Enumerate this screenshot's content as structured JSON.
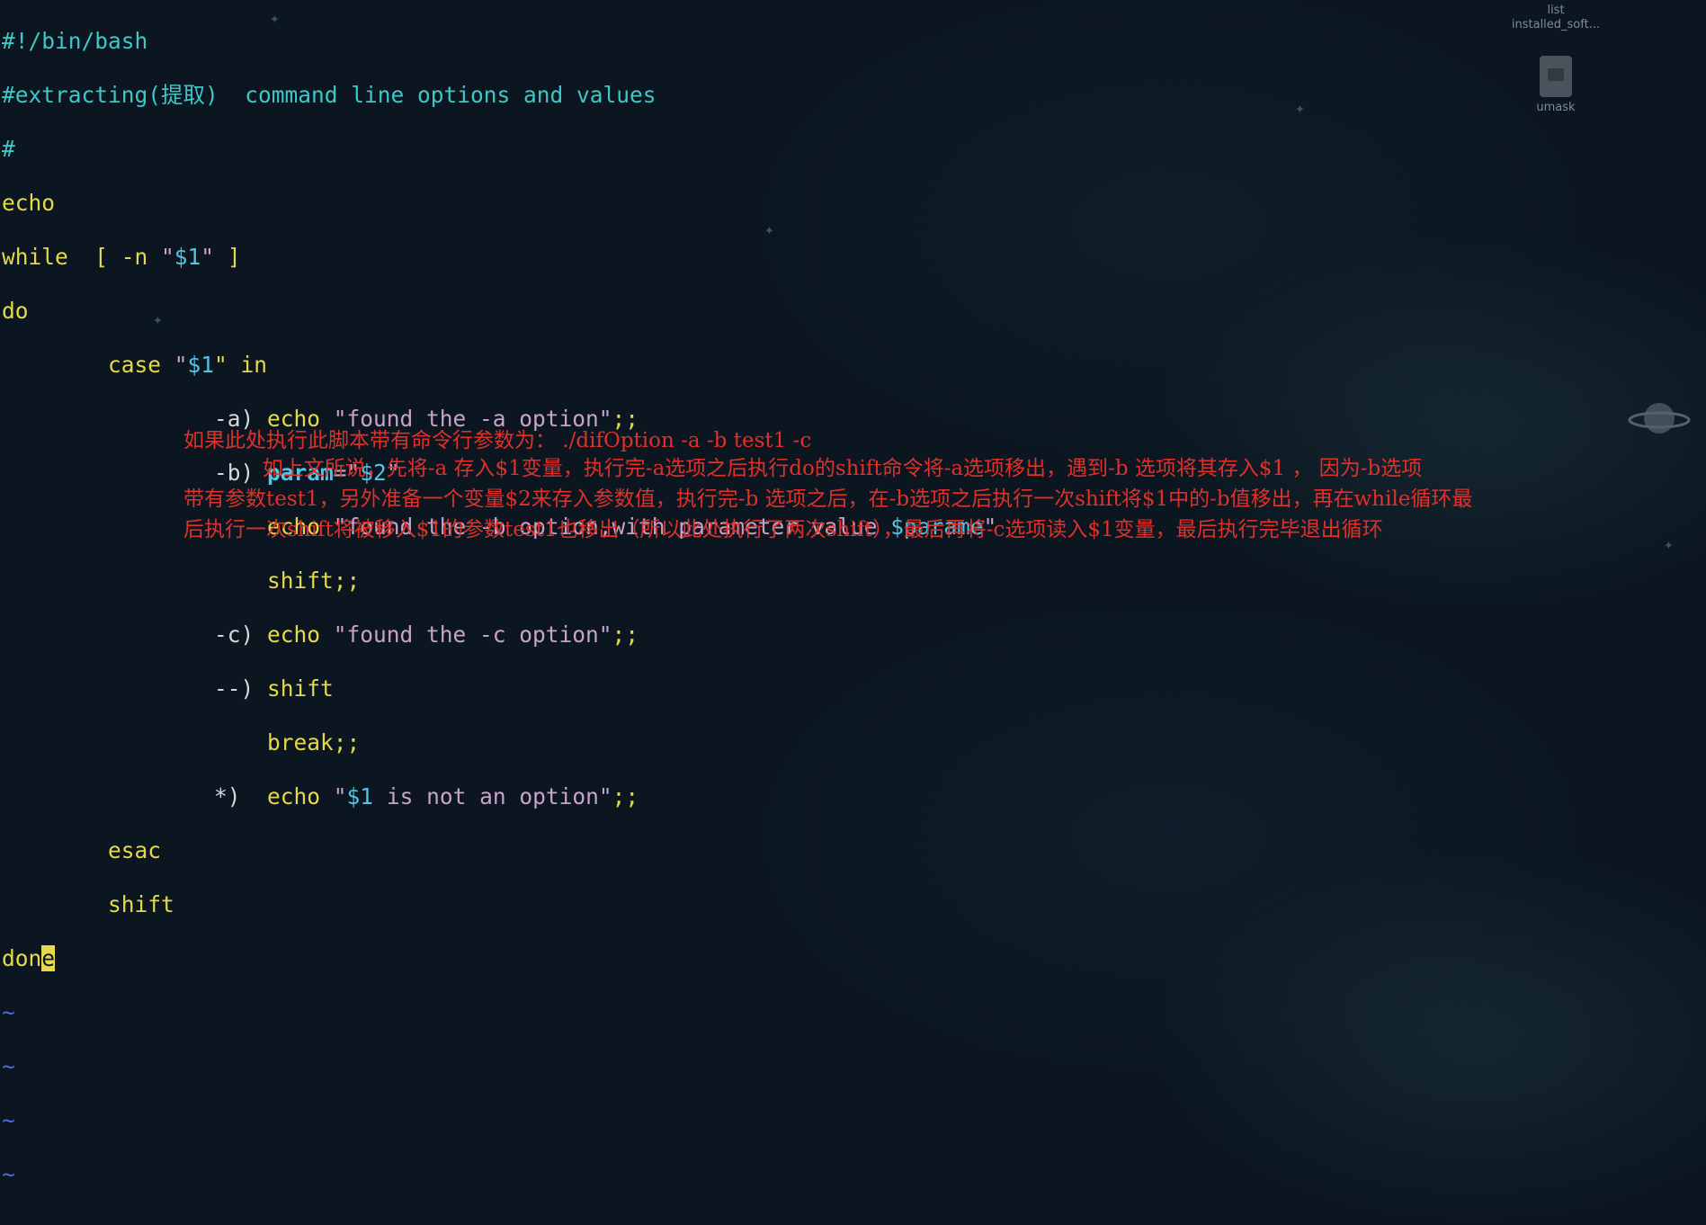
{
  "desktop": {
    "icons": [
      {
        "label_line1": "list",
        "label_line2": "installed_soft..."
      },
      {
        "label": "umask"
      }
    ]
  },
  "editor": {
    "lines": {
      "l1": "#!/bin/bash",
      "l2": "#extracting(提取)  command line options and values",
      "l3": "#",
      "l4": "echo",
      "l5a": "while  [ -n ",
      "l5b": "\"",
      "l5c": "$1",
      "l5d": "\"",
      "l5e": " ]",
      "l6": "do",
      "l7a": "        case ",
      "l7b": "\"",
      "l7c": "$1",
      "l7d": "\" in",
      "l8a": "                -a) ",
      "l8b": "echo ",
      "l8c": "\"found the -a option\"",
      "l8d": ";;",
      "l9a": "                -b) ",
      "l9b": "param",
      "l9c": "=\"",
      "l9d": "$2",
      "l9e": "\"",
      "l10a": "                    echo ",
      "l10b": "\"found the -b option,with parameter value ",
      "l10c": "$parame",
      "l10d": "\"",
      "l11": "                    shift;;",
      "l12a": "                -c) ",
      "l12b": "echo ",
      "l12c": "\"found the -c option\"",
      "l12d": ";;",
      "l13a": "                --) ",
      "l13b": "shift",
      "l14": "                    break;;",
      "l15a": "                *)  ",
      "l15b": "echo ",
      "l15c": "\"",
      "l15d": "$1",
      "l15e": " is not an option\"",
      "l15f": ";;",
      "l16": "        esac",
      "l17": "        shift",
      "l18a": "don",
      "l18b": "e",
      "tilde": "~"
    }
  },
  "annotations": {
    "note1": "如果此处执行此脚本带有命令行参数为： ./difOption -a -b test1 -c",
    "note2_line1": "            如上文所说，先将-a 存入$1变量，执行完-a选项之后执行do的shift命令将-a选项移出，遇到-b 选项将其存入$1 ， 因为-b选项",
    "note2_line2": "带有参数test1，另外准备一个变量$2来存入参数值，执行完-b 选项之后，在-b选项之后执行一次shift将$1中的-b值移出，再在while循环最",
    "note2_line3": "后执行一次shift将被移入$1的参数test1也移出（所以此处执行了两次shift），最后再将-c选项读入$1变量，最后执行完毕退出循环"
  },
  "colors": {
    "background": "#0b1620",
    "keyword": "#e5d84a",
    "comment": "#3fc6c7",
    "string": "#c8a2c8",
    "variable": "#4fc5e8",
    "annotation": "#e0302a",
    "tilde": "#4a6de0"
  }
}
